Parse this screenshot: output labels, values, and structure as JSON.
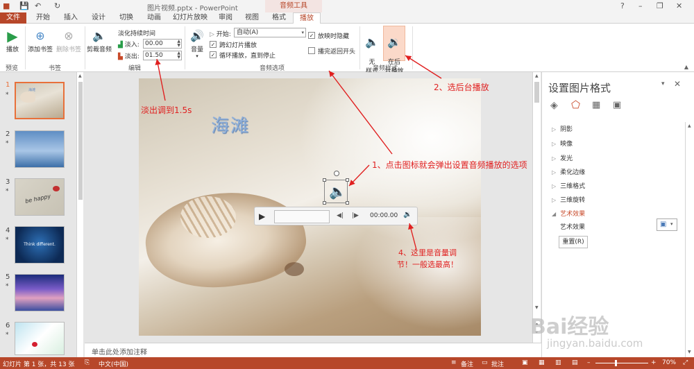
{
  "titlebar": {
    "title": "图片视频.pptx - PowerPoint",
    "contextual_tab_group": "音频工具"
  },
  "tabs": [
    "文件",
    "开始",
    "插入",
    "设计",
    "切换",
    "动画",
    "幻灯片放映",
    "审阅",
    "视图",
    "格式",
    "播放"
  ],
  "ribbon": {
    "preview": {
      "play_label": "播放",
      "group": "预览"
    },
    "bookmarks": {
      "add_label": "添加书签",
      "remove_label": "删除书签",
      "group": "书签"
    },
    "editing": {
      "trim_label": "剪裁音频",
      "fade_title": "淡化持续时间",
      "fade_in_label": "淡入:",
      "fade_in_value": "00.00",
      "fade_out_label": "淡出:",
      "fade_out_value": "01.50",
      "group": "编辑"
    },
    "audio_options": {
      "volume_label": "音量",
      "start_label": "开始:",
      "start_value": "自动(A)",
      "across_slides": "跨幻灯片播放",
      "loop": "循环播放，直到停止",
      "hide": "放映时隐藏",
      "rewind": "播完返回开头",
      "group": "音频选项"
    },
    "audio_styles": {
      "no_style": "无\n样式",
      "bg_play": "在后\n台播放",
      "group": "音频样式"
    }
  },
  "thumbnails": [
    {
      "num": "1",
      "star": "*"
    },
    {
      "num": "2",
      "star": "*"
    },
    {
      "num": "3",
      "star": "*"
    },
    {
      "num": "4",
      "star": "*"
    },
    {
      "num": "5",
      "star": "*"
    },
    {
      "num": "6",
      "star": "*"
    }
  ],
  "thumbnail_texts": {
    "t1": "海滩",
    "t3": "be happy",
    "t4": "Think different."
  },
  "slide": {
    "title": "海滩"
  },
  "player": {
    "time": "00:00.00"
  },
  "notes": {
    "placeholder": "单击此处添加注释"
  },
  "format_pane": {
    "title": "设置图片格式",
    "items": [
      "阴影",
      "映像",
      "发光",
      "柔化边缘",
      "三维格式",
      "三维旋转",
      "艺术效果"
    ],
    "art_effect_label": "艺术效果",
    "reset_button": "重置(R)"
  },
  "statusbar": {
    "slide_info": "幻灯片 第 1 张，共 13 张",
    "language": "中文(中国)",
    "notes": "备注",
    "comments": "批注",
    "zoom": "70%"
  },
  "annotations": {
    "a1": "淡出调到1.5s",
    "a2": "2、选后台播放",
    "a3": "1、点击图标就会弹出设置音频播放的选项",
    "a4": "4、这里是音量调节！一般选最高！"
  },
  "watermark": {
    "brand": "Bai经验",
    "url": "jingyan.baidu.com"
  },
  "colors": {
    "accent": "#b7472a",
    "annotation": "#e02020"
  }
}
